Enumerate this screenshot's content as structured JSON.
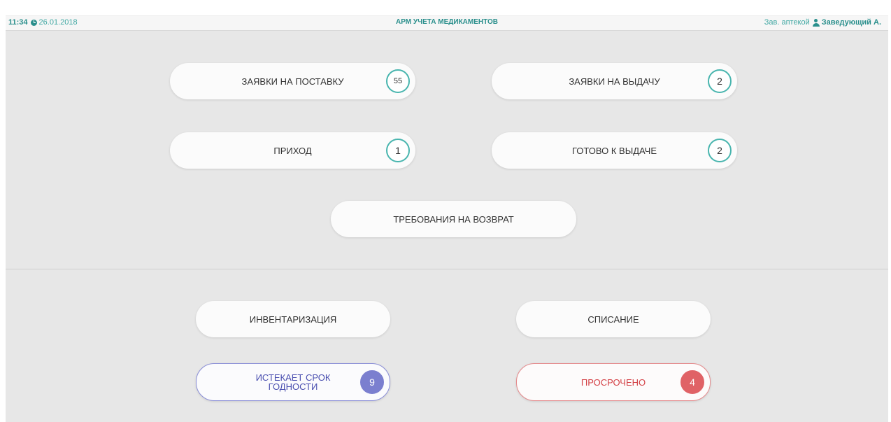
{
  "header": {
    "time": "11:34",
    "date": "26.01.2018",
    "title": "АРМ УЧЕТА МЕДИКАМЕНТОВ",
    "role": "Зав. аптекой",
    "user": "Заведующий А."
  },
  "main": {
    "supply_requests": {
      "label": "ЗАЯВКИ НА ПОСТАВКУ",
      "count": "55"
    },
    "issue_requests": {
      "label": "ЗАЯВКИ НА ВЫДАЧУ",
      "count": "2"
    },
    "receipt": {
      "label": "ПРИХОД",
      "count": "1"
    },
    "ready_to_issue": {
      "label": "ГОТОВО К ВЫДАЧЕ",
      "count": "2"
    },
    "return_requests": {
      "label": "ТРЕБОВАНИЯ НА ВОЗВРАТ"
    }
  },
  "secondary": {
    "inventory": {
      "label": "ИНВЕНТАРИЗАЦИЯ"
    },
    "write_off": {
      "label": "СПИСАНИЕ"
    },
    "expiring": {
      "label_line1": "ИСТЕКАЕТ СРОК",
      "label_line2": "ГОДНОСТИ",
      "count": "9"
    },
    "expired": {
      "label": "ПРОСРОЧЕНО",
      "count": "4"
    }
  },
  "colors": {
    "accent": "#2a8f8c",
    "badge_outline": "#48b5ae",
    "expiring": "#7b7fcf",
    "expired": "#e06266",
    "panel": "#e7e7e7"
  }
}
